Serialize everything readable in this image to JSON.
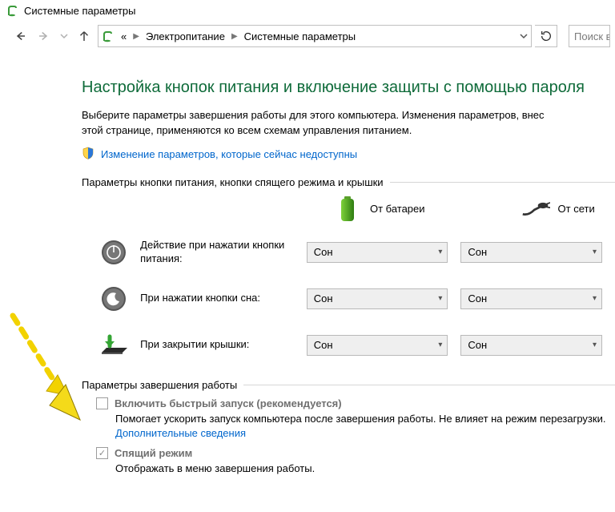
{
  "window": {
    "title": "Системные параметры"
  },
  "nav": {
    "back_enabled": true,
    "forward_enabled": false,
    "chevron_enabled": false,
    "up_enabled": true,
    "refresh_enabled": true,
    "search_placeholder": "Поиск в",
    "breadcrumbs": {
      "root_symbol": "«",
      "seg1": "Электропитание",
      "seg2": "Системные параметры"
    }
  },
  "main": {
    "heading": "Настройка кнопок питания и включение защиты с помощью пароля",
    "description_line1": "Выберите параметры завершения работы для этого компьютера. Изменения параметров, внес",
    "description_line2": "этой странице, применяются ко всем схемам управления питанием.",
    "admin_link": "Изменение параметров, которые сейчас недоступны",
    "group1_label": "Параметры кнопки питания, кнопки спящего режима и крышки",
    "columns": {
      "battery": "От батареи",
      "mains": "От сети"
    },
    "rows": [
      {
        "icon": "power",
        "label": "Действие при нажатии кнопки питания:",
        "battery_value": "Сон",
        "mains_value": "Сон"
      },
      {
        "icon": "sleep",
        "label": "При нажатии кнопки сна:",
        "battery_value": "Сон",
        "mains_value": "Сон"
      },
      {
        "icon": "lid",
        "label": "При закрытии крышки:",
        "battery_value": "Сон",
        "mains_value": "Сон"
      }
    ],
    "group2_label": "Параметры завершения работы",
    "shutdown": [
      {
        "checked": false,
        "title": "Включить быстрый запуск (рекомендуется)",
        "desc_prefix": "Помогает ускорить запуск компьютера после завершения работы. Не влияет на режим перезагрузки. ",
        "link": "Дополнительные сведения"
      },
      {
        "checked": true,
        "title": "Спящий режим",
        "desc_prefix": "Отображать в меню завершения работы.",
        "link": ""
      }
    ]
  }
}
